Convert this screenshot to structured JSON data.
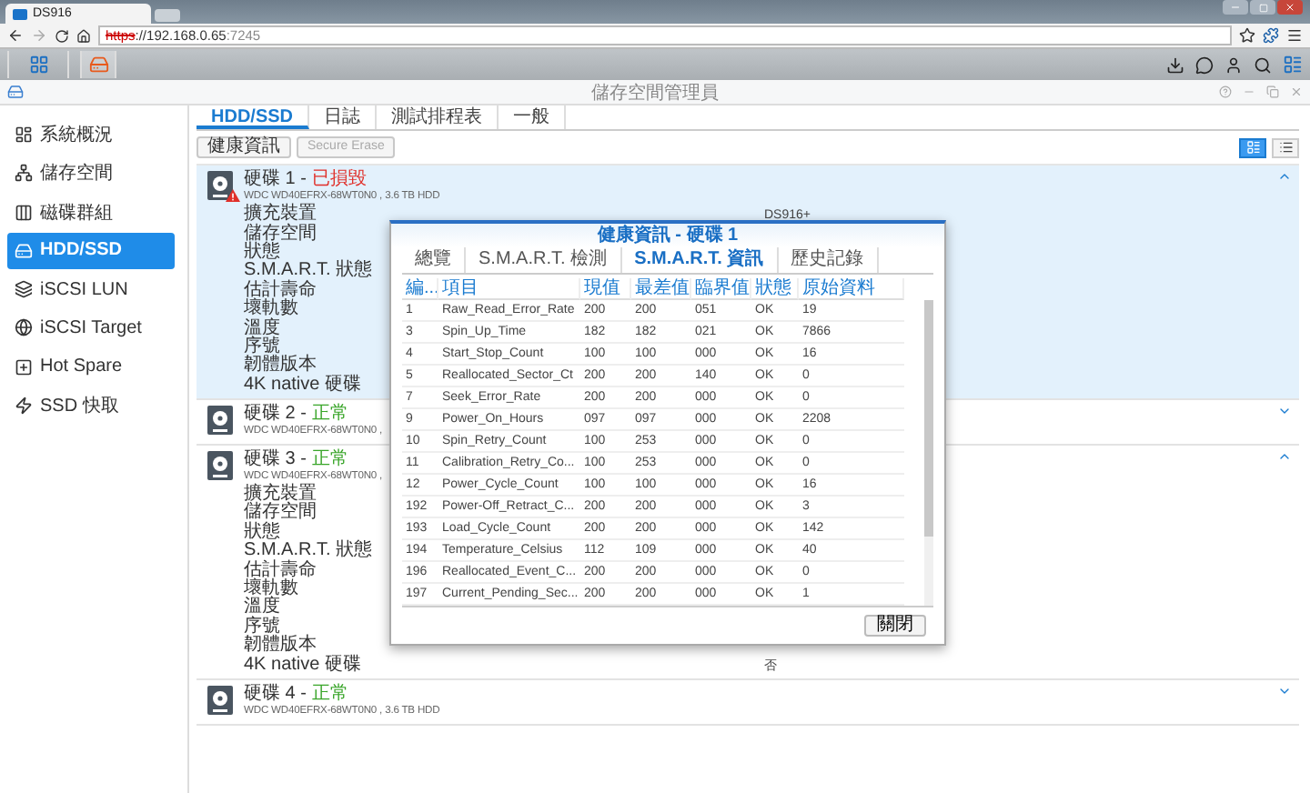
{
  "browser": {
    "tab_title": "DS916",
    "url_scheme": "https",
    "url_host": "://192.168.0.65",
    "url_port": ":7245"
  },
  "window": {
    "title": "儲存空間管理員"
  },
  "sidebar": {
    "items": [
      {
        "label": "系統概況",
        "selected": false
      },
      {
        "label": "儲存空間",
        "selected": false
      },
      {
        "label": "磁碟群組",
        "selected": false
      },
      {
        "label": "HDD/SSD",
        "selected": true
      },
      {
        "label": "iSCSI LUN",
        "selected": false
      },
      {
        "label": "iSCSI Target",
        "selected": false
      },
      {
        "label": "Hot Spare",
        "selected": false
      },
      {
        "label": "SSD 快取",
        "selected": false
      }
    ]
  },
  "tabs": [
    {
      "label": "HDD/SSD",
      "selected": true
    },
    {
      "label": "日誌",
      "selected": false
    },
    {
      "label": "測試排程表",
      "selected": false
    },
    {
      "label": "一般",
      "selected": false
    }
  ],
  "toolbar": {
    "buttons": [
      {
        "label": "健康資訊",
        "disabled": false
      },
      {
        "label": "Secure Erase",
        "disabled": true
      }
    ],
    "views": [
      {
        "kind": "detail",
        "selected": true
      },
      {
        "kind": "list",
        "selected": false
      }
    ]
  },
  "disks": [
    {
      "title": "硬碟 1 -",
      "status": "已損毀",
      "failed": true,
      "selected": true,
      "expanded": true,
      "model": "WDC WD40EFRX-68WT0N0 , 3.6 TB HDD",
      "fields": [
        {
          "label": "擴充裝置",
          "value": "DS916+"
        },
        {
          "label": "儲存空間"
        },
        {
          "label": "狀態"
        },
        {
          "label": "S.M.A.R.T. 狀態"
        },
        {
          "label": "估計壽命"
        },
        {
          "label": "壞軌數"
        },
        {
          "label": "溫度"
        },
        {
          "label": "序號"
        },
        {
          "label": "韌體版本"
        },
        {
          "label": "4K native 硬碟"
        }
      ]
    },
    {
      "title": "硬碟 2 -",
      "status": "正常",
      "failed": false,
      "selected": false,
      "expanded": false,
      "model": "WDC WD40EFRX-68WT0N0 ,"
    },
    {
      "title": "硬碟 3 -",
      "status": "正常",
      "failed": false,
      "selected": false,
      "expanded": true,
      "model": "WDC WD40EFRX-68WT0N0 ,",
      "fields": [
        {
          "label": "擴充裝置"
        },
        {
          "label": "儲存空間"
        },
        {
          "label": "狀態"
        },
        {
          "label": "S.M.A.R.T. 狀態"
        },
        {
          "label": "估計壽命"
        },
        {
          "label": "壞軌數"
        },
        {
          "label": "溫度"
        },
        {
          "label": "序號"
        },
        {
          "label": "韌體版本"
        },
        {
          "label": "4K native 硬碟",
          "value": "否"
        }
      ]
    },
    {
      "title": "硬碟 4 -",
      "status": "正常",
      "failed": false,
      "selected": false,
      "expanded": false,
      "model": "WDC WD40EFRX-68WT0N0 , 3.6 TB HDD"
    }
  ],
  "dialog": {
    "title": "健康資訊 - 硬碟 1",
    "tabs": [
      {
        "label": "總覽",
        "selected": false
      },
      {
        "label": "S.M.A.R.T. 檢測",
        "selected": false
      },
      {
        "label": "S.M.A.R.T. 資訊",
        "selected": true
      },
      {
        "label": "歷史記錄",
        "selected": false
      }
    ],
    "table": {
      "columns": [
        "編...",
        "項目",
        "現值",
        "最差值",
        "臨界值",
        "狀態",
        "原始資料"
      ],
      "rows": [
        [
          "1",
          "Raw_Read_Error_Rate",
          "200",
          "200",
          "051",
          "OK",
          "19"
        ],
        [
          "3",
          "Spin_Up_Time",
          "182",
          "182",
          "021",
          "OK",
          "7866"
        ],
        [
          "4",
          "Start_Stop_Count",
          "100",
          "100",
          "000",
          "OK",
          "16"
        ],
        [
          "5",
          "Reallocated_Sector_Ct",
          "200",
          "200",
          "140",
          "OK",
          "0"
        ],
        [
          "7",
          "Seek_Error_Rate",
          "200",
          "200",
          "000",
          "OK",
          "0"
        ],
        [
          "9",
          "Power_On_Hours",
          "097",
          "097",
          "000",
          "OK",
          "2208"
        ],
        [
          "10",
          "Spin_Retry_Count",
          "100",
          "253",
          "000",
          "OK",
          "0"
        ],
        [
          "11",
          "Calibration_Retry_Co...",
          "100",
          "253",
          "000",
          "OK",
          "0"
        ],
        [
          "12",
          "Power_Cycle_Count",
          "100",
          "100",
          "000",
          "OK",
          "16"
        ],
        [
          "192",
          "Power-Off_Retract_C...",
          "200",
          "200",
          "000",
          "OK",
          "3"
        ],
        [
          "193",
          "Load_Cycle_Count",
          "200",
          "200",
          "000",
          "OK",
          "142"
        ],
        [
          "194",
          "Temperature_Celsius",
          "112",
          "109",
          "000",
          "OK",
          "40"
        ],
        [
          "196",
          "Reallocated_Event_C...",
          "200",
          "200",
          "000",
          "OK",
          "0"
        ],
        [
          "197",
          "Current_Pending_Sec...",
          "200",
          "200",
          "000",
          "OK",
          "1"
        ]
      ]
    },
    "close_button": "關閉"
  }
}
